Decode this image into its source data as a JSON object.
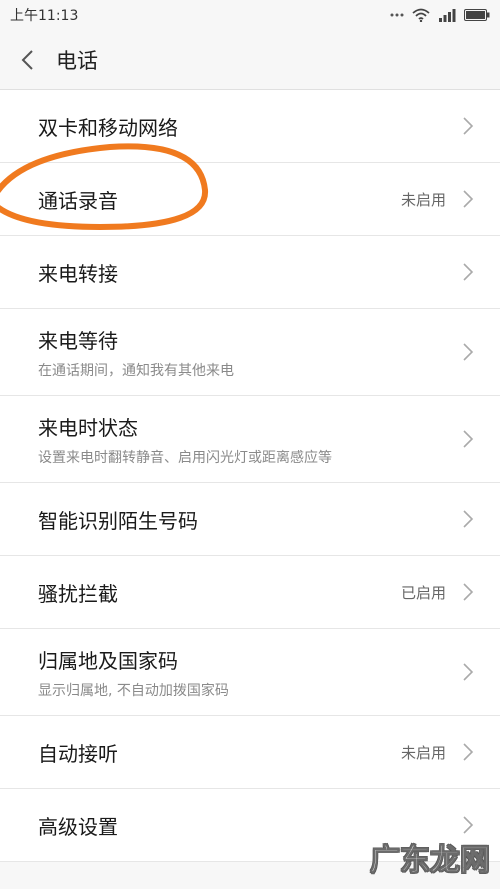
{
  "status_bar": {
    "time": "上午11:13",
    "icons": [
      "dots-icon",
      "wifi-icon",
      "signal-icon",
      "battery-icon"
    ]
  },
  "header": {
    "title": "电话"
  },
  "settings": [
    {
      "title": "双卡和移动网络",
      "subtitle": "",
      "value": ""
    },
    {
      "title": "通话录音",
      "subtitle": "",
      "value": "未启用"
    },
    {
      "title": "来电转接",
      "subtitle": "",
      "value": ""
    },
    {
      "title": "来电等待",
      "subtitle": "在通话期间，通知我有其他来电",
      "value": ""
    },
    {
      "title": "来电时状态",
      "subtitle": "设置来电时翻转静音、启用闪光灯或距离感应等",
      "value": ""
    },
    {
      "title": "智能识别陌生号码",
      "subtitle": "",
      "value": ""
    },
    {
      "title": "骚扰拦截",
      "subtitle": "",
      "value": "已启用"
    },
    {
      "title": "归属地及国家码",
      "subtitle": "显示归属地, 不自动加拨国家码",
      "value": ""
    },
    {
      "title": "自动接听",
      "subtitle": "",
      "value": "未启用"
    },
    {
      "title": "高级设置",
      "subtitle": "",
      "value": ""
    }
  ],
  "annotation": {
    "color": "#f07a1f"
  },
  "watermark": {
    "text": "广东龙网"
  }
}
